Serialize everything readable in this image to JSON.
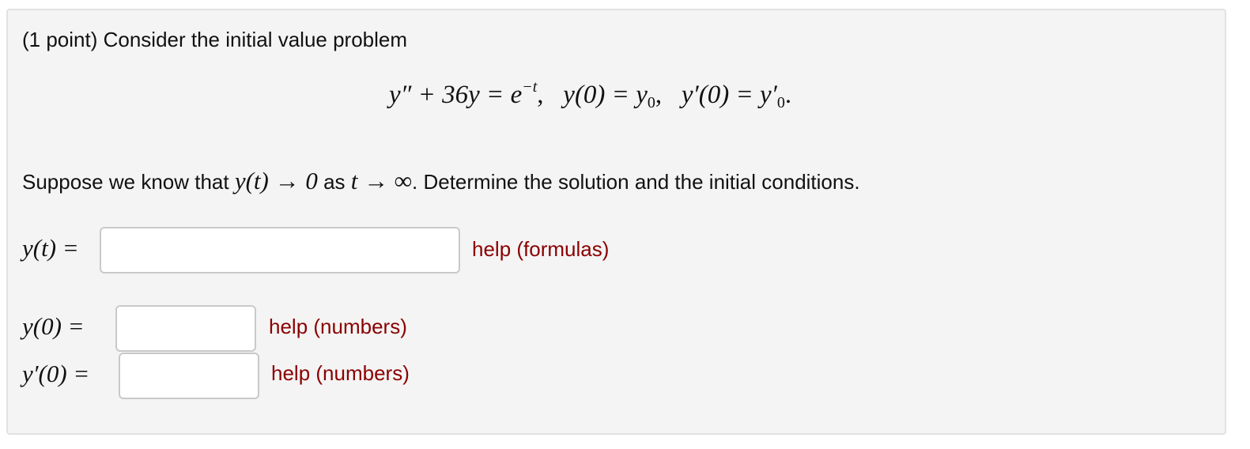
{
  "problem": {
    "intro": "(1 point) Consider the initial value problem",
    "equation": {
      "lhs": "y″ + 36y = e",
      "exponent": "−t",
      "comma1": ",",
      "cond1_lhs": "y(0) = y",
      "cond1_sub": "0",
      "comma2": ",",
      "cond2_lhs": "y′(0) = y′",
      "cond2_sub": "0",
      "period": "."
    },
    "condition": {
      "prefix": "Suppose we know that ",
      "math1": "y(t) → 0",
      "middle": " as ",
      "math2": "t → ∞",
      "suffix": ". Determine the solution and the initial conditions."
    }
  },
  "answers": [
    {
      "label": "y(t) =",
      "value": "",
      "help": "help (formulas)"
    },
    {
      "label": "y(0) =",
      "value": "",
      "help": "help (numbers)"
    },
    {
      "label": "y′(0) =",
      "value": "",
      "help": "help (numbers)"
    }
  ]
}
